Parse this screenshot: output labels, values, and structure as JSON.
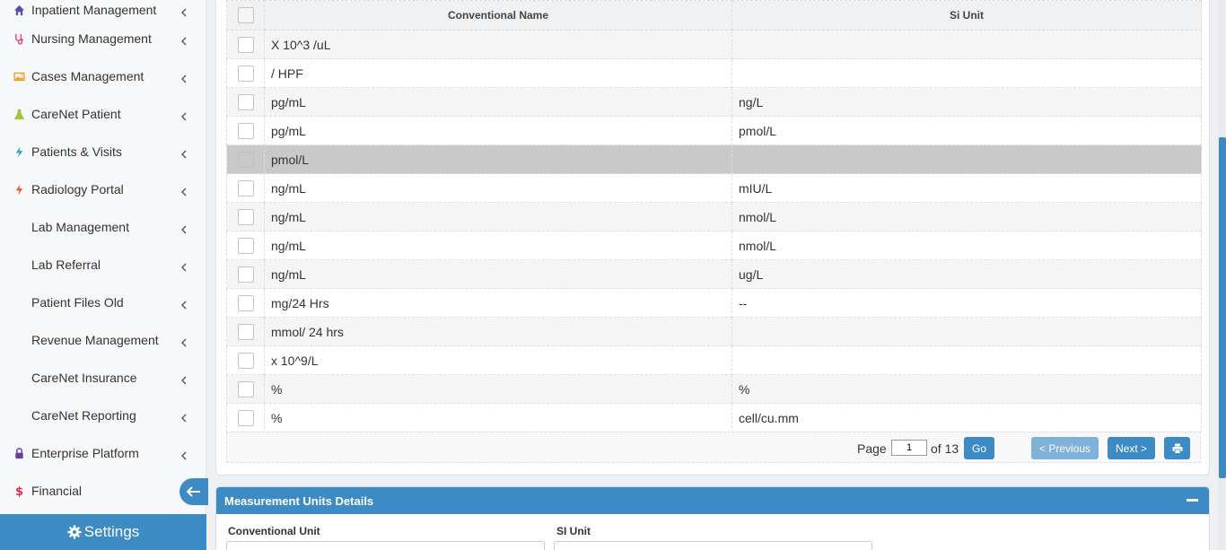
{
  "sidebar": {
    "items": [
      {
        "label": "Inpatient Management",
        "icon": "home-icon",
        "icon_color": "#5b4ea8"
      },
      {
        "label": "Nursing Management",
        "icon": "stethoscope-icon",
        "icon_color": "#e0457b"
      },
      {
        "label": "Cases Management",
        "icon": "image-icon",
        "icon_color": "#f29a1e"
      },
      {
        "label": "CareNet Patient",
        "icon": "flask-icon",
        "icon_color": "#a4c639"
      },
      {
        "label": "Patients & Visits",
        "icon": "bolt-icon",
        "icon_color": "#1fa9c4"
      },
      {
        "label": "Radiology Portal",
        "icon": "bolt-icon",
        "icon_color": "#e2562c"
      },
      {
        "label": "Lab Management",
        "icon": "",
        "icon_color": ""
      },
      {
        "label": "Lab Referral",
        "icon": "",
        "icon_color": ""
      },
      {
        "label": "Patient Files Old",
        "icon": "",
        "icon_color": ""
      },
      {
        "label": "Revenue Management",
        "icon": "",
        "icon_color": ""
      },
      {
        "label": "CareNet Insurance",
        "icon": "",
        "icon_color": ""
      },
      {
        "label": "CareNet Reporting",
        "icon": "",
        "icon_color": ""
      },
      {
        "label": "Enterprise Platform",
        "icon": "lock-icon",
        "icon_color": "#6a3ea1"
      },
      {
        "label": "Financial",
        "icon": "dollar-icon",
        "icon_color": "#d9334f"
      }
    ],
    "settings_label": "Settings"
  },
  "grid": {
    "columns": [
      "Conventional Name",
      "Si Unit"
    ],
    "rows": [
      {
        "conventional": "X 10^3 /uL",
        "si": "",
        "selected": false
      },
      {
        "conventional": "/ HPF",
        "si": "",
        "selected": false
      },
      {
        "conventional": "pg/mL",
        "si": "ng/L",
        "selected": false
      },
      {
        "conventional": "pg/mL",
        "si": "pmol/L",
        "selected": false
      },
      {
        "conventional": "pmol/L",
        "si": "",
        "selected": true
      },
      {
        "conventional": "ng/mL",
        "si": "mIU/L",
        "selected": false
      },
      {
        "conventional": "ng/mL",
        "si": "nmol/L",
        "selected": false
      },
      {
        "conventional": "ng/mL",
        "si": "nmol/L",
        "selected": false
      },
      {
        "conventional": "ng/mL",
        "si": "ug/L",
        "selected": false
      },
      {
        "conventional": "mg/24 Hrs",
        "si": "--",
        "selected": false
      },
      {
        "conventional": "mmol/ 24 hrs",
        "si": "",
        "selected": false
      },
      {
        "conventional": "x 10^9/L",
        "si": "",
        "selected": false
      },
      {
        "conventional": "%",
        "si": "%",
        "selected": false
      },
      {
        "conventional": "%",
        "si": "cell/cu.mm",
        "selected": false
      }
    ]
  },
  "pager": {
    "page_label": "Page",
    "current_page": "1",
    "of_label": "of 13",
    "go_label": "Go",
    "prev_label": "< Previous",
    "next_label": "Next >"
  },
  "details": {
    "title": "Measurement Units Details",
    "conventional_label": "Conventional Unit",
    "si_label": "SI Unit"
  },
  "colors": {
    "accent": "#3d8bc4",
    "selected_row": "#c9c9c9"
  }
}
